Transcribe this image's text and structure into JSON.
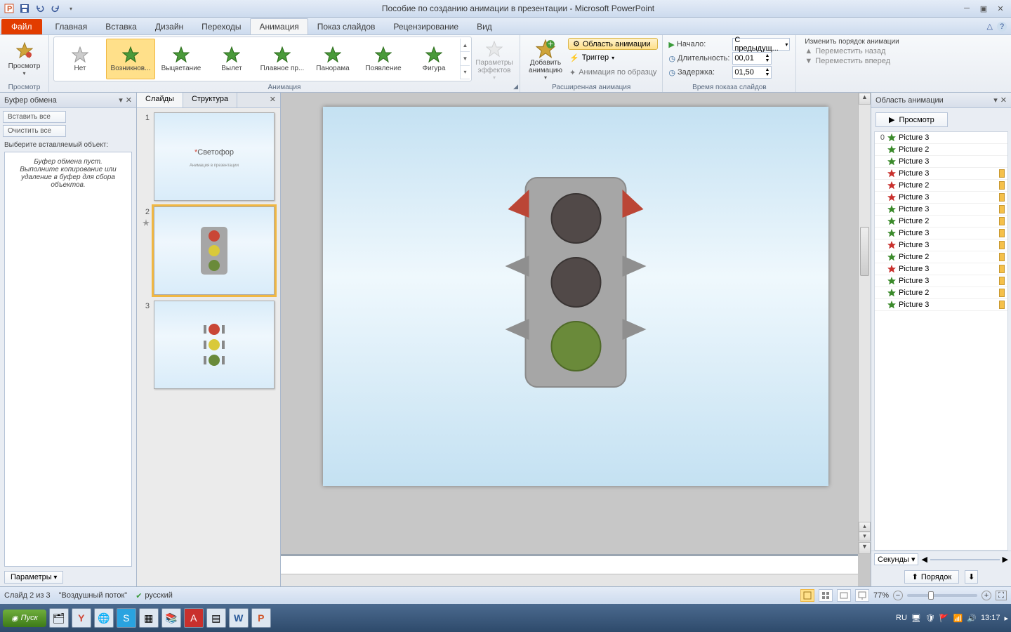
{
  "window": {
    "title": "Пособие по созданию анимации в презентации - Microsoft PowerPoint"
  },
  "tabs": {
    "file": "Файл",
    "items": [
      "Главная",
      "Вставка",
      "Дизайн",
      "Переходы",
      "Анимация",
      "Показ слайдов",
      "Рецензирование",
      "Вид"
    ],
    "active_index": 4
  },
  "ribbon": {
    "preview": {
      "label": "Просмотр",
      "group": "Просмотр"
    },
    "gallery": {
      "group": "Анимация",
      "items": [
        "Нет",
        "Возникнов...",
        "Выцветание",
        "Вылет",
        "Плавное пр...",
        "Панорама",
        "Появление",
        "Фигура"
      ],
      "selected_index": 1
    },
    "effect_options": "Параметры эффектов",
    "advanced": {
      "group": "Расширенная анимация",
      "add": "Добавить анимацию",
      "pane": "Область анимации",
      "trigger": "Триггер",
      "painter": "Анимация по образцу"
    },
    "timing": {
      "group": "Время показа слайдов",
      "start_label": "Начало:",
      "start_value": "С предыдущ...",
      "duration_label": "Длительность:",
      "duration_value": "00,01",
      "delay_label": "Задержка:",
      "delay_value": "01,50"
    },
    "reorder": {
      "title": "Изменить порядок анимации",
      "back": "Переместить назад",
      "forward": "Переместить вперед"
    }
  },
  "clipboard_pane": {
    "title": "Буфер обмена",
    "paste_all": "Вставить все",
    "clear_all": "Очистить все",
    "select_label": "Выберите вставляемый объект:",
    "empty_msg": "Буфер обмена пуст.\nВыполните копирование или удаление в буфер для сбора объектов.",
    "options": "Параметры"
  },
  "slide_panel": {
    "tab_slides": "Слайды",
    "tab_outline": "Структура",
    "slides": [
      {
        "num": "1",
        "title": "Светофор",
        "subtitle": "Анимация в презентации"
      },
      {
        "num": "2"
      },
      {
        "num": "3"
      }
    ],
    "selected_index": 1
  },
  "anim_pane": {
    "title": "Область анимации",
    "play": "Просмотр",
    "items": [
      {
        "idx": "0",
        "type": "g",
        "name": "Picture 3",
        "bar": false
      },
      {
        "idx": "",
        "type": "g",
        "name": "Picture 2",
        "bar": false
      },
      {
        "idx": "",
        "type": "g",
        "name": "Picture 3",
        "bar": false
      },
      {
        "idx": "",
        "type": "r",
        "name": "Picture 3",
        "bar": true
      },
      {
        "idx": "",
        "type": "r",
        "name": "Picture 2",
        "bar": true
      },
      {
        "idx": "",
        "type": "r",
        "name": "Picture 3",
        "bar": true
      },
      {
        "idx": "",
        "type": "g",
        "name": "Picture 3",
        "bar": true
      },
      {
        "idx": "",
        "type": "g",
        "name": "Picture 2",
        "bar": true
      },
      {
        "idx": "",
        "type": "g",
        "name": "Picture 3",
        "bar": true
      },
      {
        "idx": "",
        "type": "r",
        "name": "Picture 3",
        "bar": true
      },
      {
        "idx": "",
        "type": "g",
        "name": "Picture 2",
        "bar": true
      },
      {
        "idx": "",
        "type": "r",
        "name": "Picture 3",
        "bar": true
      },
      {
        "idx": "",
        "type": "g",
        "name": "Picture 3",
        "bar": true
      },
      {
        "idx": "",
        "type": "g",
        "name": "Picture 2",
        "bar": true
      },
      {
        "idx": "",
        "type": "g",
        "name": "Picture 3",
        "bar": true
      }
    ],
    "seconds": "Секунды",
    "reorder": "Порядок"
  },
  "statusbar": {
    "slide": "Слайд 2 из 3",
    "theme": "\"Воздушный поток\"",
    "language": "русский",
    "zoom": "77%"
  },
  "taskbar": {
    "start": "Пуск",
    "lang": "RU",
    "time": "13:17"
  }
}
